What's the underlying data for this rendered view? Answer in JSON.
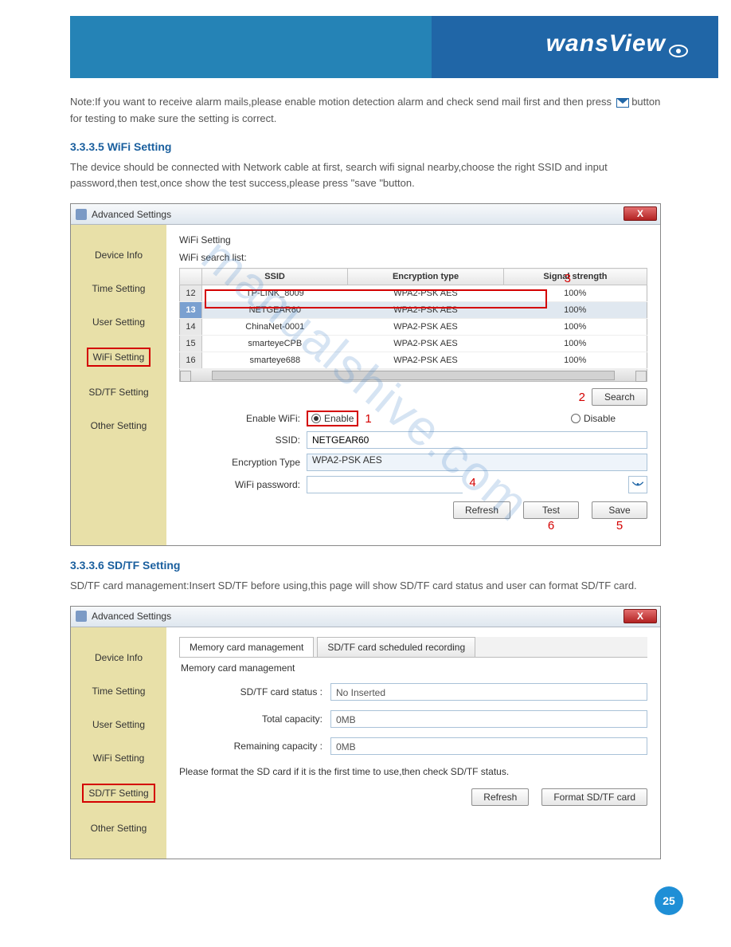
{
  "brand": "wansView",
  "intro_text": "Note:If you want to receive alarm mails,please enable motion detection alarm and check send mail first and then press [icon] button for testing to make sure the setting is correct.",
  "wifi": {
    "heading": "3.3.3.5 WiFi Setting",
    "desc": "The device should be connected with Network cable at first, search wifi signal nearby,choose the right SSID and input password,then test,once show the test success,please press \"save \"button.",
    "window_title": "Advanced Settings",
    "sidebar": [
      "Device Info",
      "Time Setting",
      "User Setting",
      "WiFi Setting",
      "SD/TF Setting",
      "Other Setting"
    ],
    "panel_title": "WiFi Setting",
    "list_label": "WiFi search list:",
    "table": {
      "headers": [
        "",
        "SSID",
        "Encryption type",
        "Signal strength"
      ],
      "rows": [
        {
          "idx": "12",
          "ssid": "TP-LINK_8009",
          "enc": "WPA2-PSK AES",
          "sig": "100%"
        },
        {
          "idx": "13",
          "ssid": "NETGEAR60",
          "enc": "WPA2-PSK AES",
          "sig": "100%",
          "selected": true
        },
        {
          "idx": "14",
          "ssid": "ChinaNet-0001",
          "enc": "WPA2-PSK AES",
          "sig": "100%"
        },
        {
          "idx": "15",
          "ssid": "smarteyeCPB",
          "enc": "WPA2-PSK AES",
          "sig": "100%"
        },
        {
          "idx": "16",
          "ssid": "smarteye688",
          "enc": "WPA2-PSK AES",
          "sig": "100%"
        }
      ]
    },
    "search_btn": "Search",
    "enable_label": "Enable WiFi:",
    "enable_opt": "Enable",
    "disable_opt": "Disable",
    "ssid_label": "SSID:",
    "ssid_val": "NETGEAR60",
    "enc_label": "Encryption Type",
    "enc_val": "WPA2-PSK AES",
    "pwd_label": "WiFi password:",
    "pwd_val": "",
    "refresh_btn": "Refresh",
    "test_btn": "Test",
    "save_btn": "Save",
    "callouts": {
      "c1": "1",
      "c2": "2",
      "c3": "3",
      "c4": "4",
      "c5": "5",
      "c6": "6"
    }
  },
  "sd": {
    "heading": "3.3.3.6 SD/TF Setting",
    "desc": "SD/TF card management:Insert SD/TF before using,this page will show SD/TF card status and user can format SD/TF card.",
    "window_title": "Advanced Settings",
    "sidebar": [
      "Device Info",
      "Time Setting",
      "User Setting",
      "WiFi Setting",
      "SD/TF Setting",
      "Other Setting"
    ],
    "tab1": "Memory card management",
    "tab2": "SD/TF card scheduled recording",
    "section_label": "Memory card management",
    "status_label": "SD/TF card status :",
    "status_val": "No Inserted",
    "total_label": "Total capacity:",
    "total_val": "0MB",
    "remain_label": "Remaining capacity :",
    "remain_val": "0MB",
    "hint": "Please format the SD card if it is the first time to use,then check SD/TF status.",
    "refresh_btn": "Refresh",
    "format_btn": "Format SD/TF card"
  },
  "watermark": "manualshive.com",
  "page_num": "25"
}
